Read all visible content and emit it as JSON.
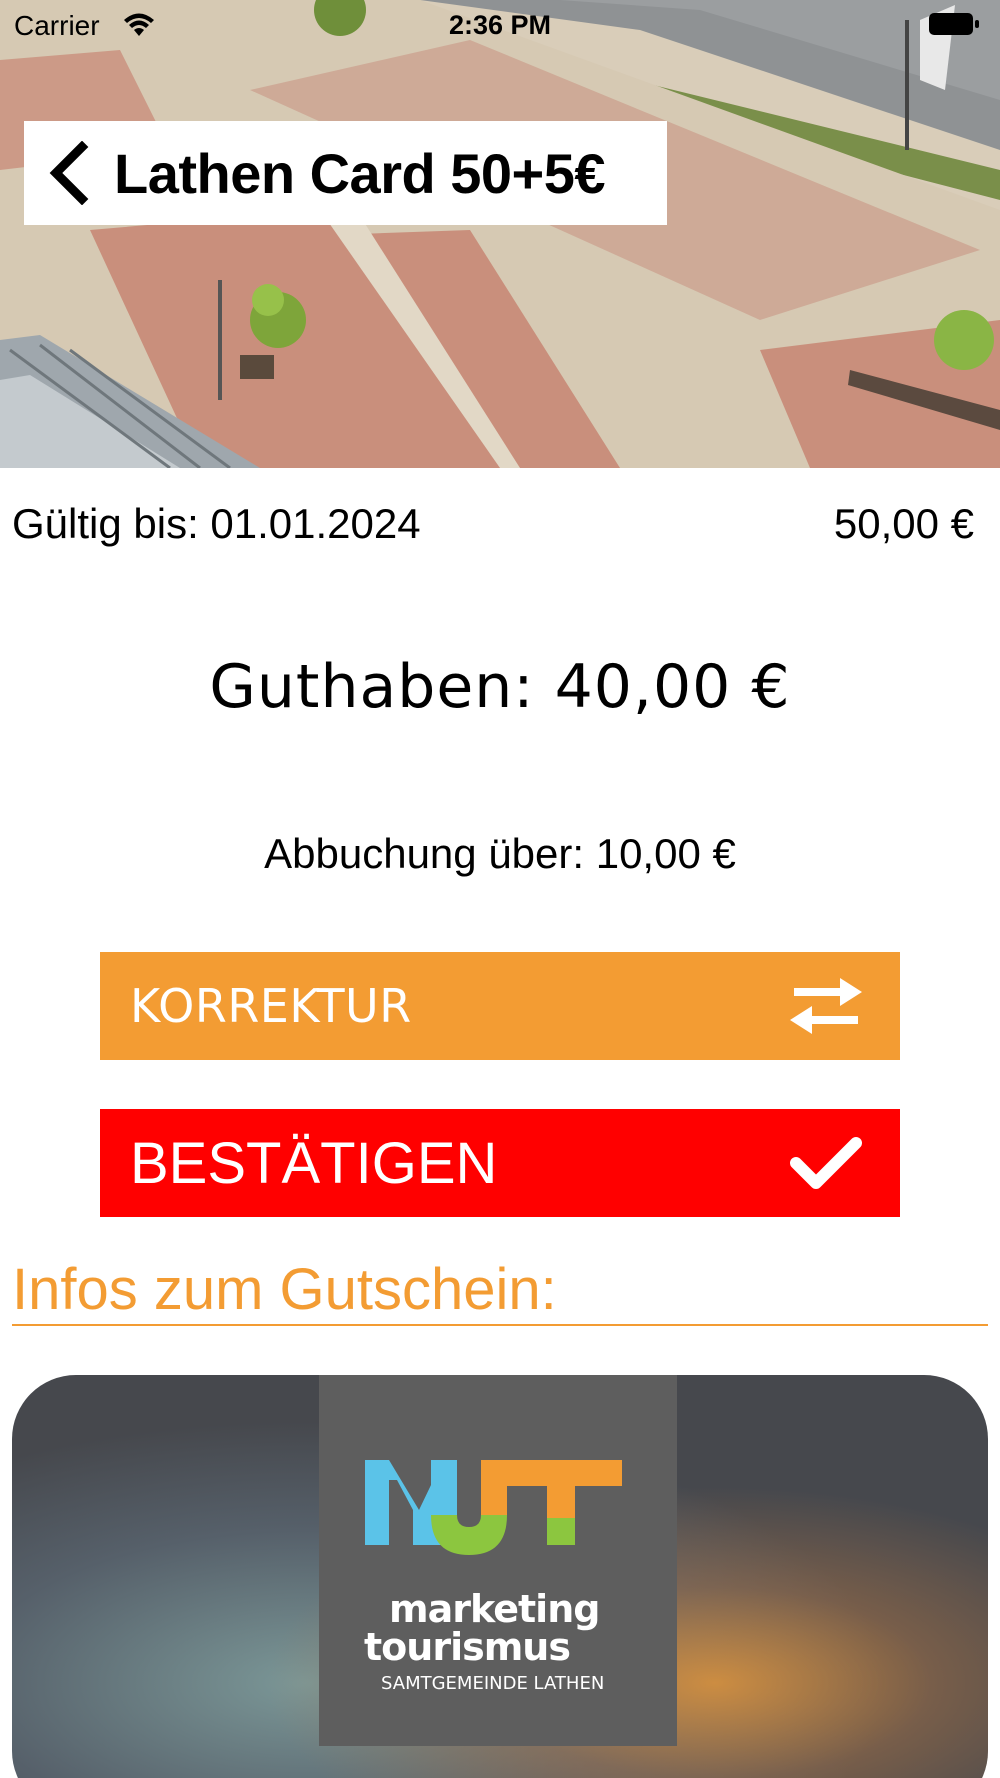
{
  "status_bar": {
    "carrier": "Carrier",
    "time": "2:36 PM"
  },
  "header": {
    "title": "Lathen Card 50+5€",
    "back_icon": "chevron-left-icon"
  },
  "voucher": {
    "valid_until": "Gültig bis: 01.01.2024",
    "price": "50,00 €",
    "balance": "Guthaben: 40,00 €",
    "debit": "Abbuchung über: 10,00 €"
  },
  "buttons": {
    "korrektur_label": "KORREKTUR",
    "korrektur_icon": "swap-arrows-icon",
    "confirm_label": "BESTÄTIGEN",
    "confirm_icon": "checkmark-icon"
  },
  "info_section": {
    "title": "Infos zum Gutschein:",
    "logo": {
      "word1": "marketing",
      "word2": "tourismus",
      "word3": "SAMTGEMEINDE LATHEN"
    }
  },
  "colors": {
    "accent_orange": "#f39c33",
    "confirm_red": "#ff0000",
    "logo_blue": "#5bc3e8",
    "logo_green": "#8cc63f",
    "logo_orange": "#f39c33"
  }
}
